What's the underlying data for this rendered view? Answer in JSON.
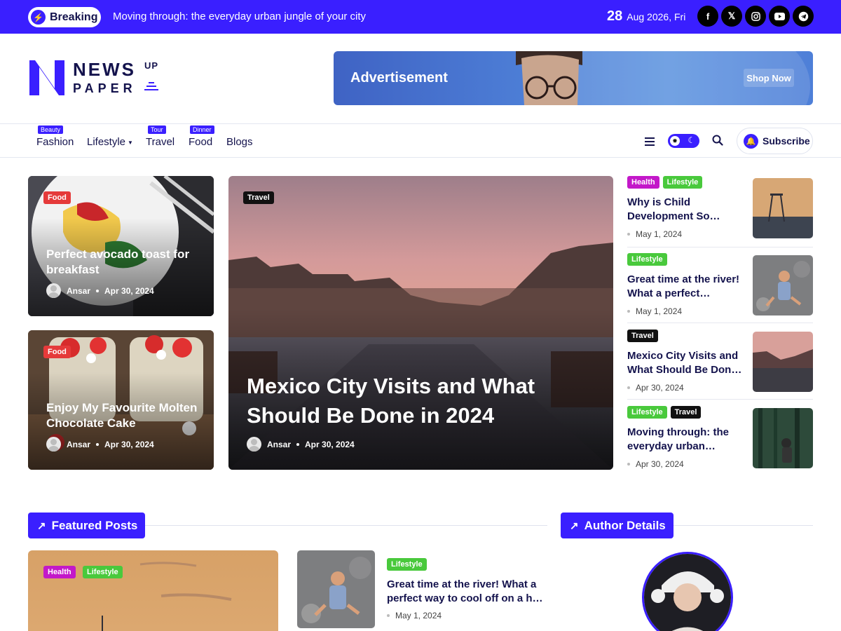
{
  "topbar": {
    "breaking_label": "Breaking",
    "ticker": "Moving through: the everyday urban jungle of your city",
    "date_day": "28",
    "date_rest": "Aug 2026, Fri",
    "socials": [
      "facebook-icon",
      "x-icon",
      "instagram-icon",
      "youtube-icon",
      "telegram-icon"
    ]
  },
  "logo": {
    "word1": "NEWS",
    "word2": "PAPER",
    "word3": "UP"
  },
  "ad": {
    "label": "Advertisement",
    "cta": "Shop Now"
  },
  "nav": {
    "items": [
      {
        "label": "Fashion",
        "tag": "Beauty"
      },
      {
        "label": "Lifestyle",
        "tag": ""
      },
      {
        "label": "Travel",
        "tag": "Tour"
      },
      {
        "label": "Food",
        "tag": "Dinner"
      },
      {
        "label": "Blogs",
        "tag": ""
      }
    ],
    "subscribe": "Subscribe"
  },
  "cards": {
    "left1": {
      "tag": "Food",
      "title": "Perfect avocado toast for breakfast",
      "author": "Ansar",
      "date": "Apr 30, 2024"
    },
    "left2": {
      "tag": "Food",
      "title": "Enjoy My Favourite Molten Chocolate Cake",
      "author": "Ansar",
      "date": "Apr 30, 2024"
    },
    "main": {
      "tag": "Travel",
      "title": "Mexico City Visits and What Should Be Done in 2024",
      "author": "Ansar",
      "date": "Apr 30, 2024"
    }
  },
  "side": [
    {
      "tags": [
        "Health",
        "Lifestyle"
      ],
      "title": "Why is Child Development So…",
      "date": "May 1, 2024"
    },
    {
      "tags": [
        "Lifestyle"
      ],
      "title": "Great time at the river! What a perfect…",
      "date": "May 1, 2024"
    },
    {
      "tags": [
        "Travel"
      ],
      "title": "Mexico City Visits and What Should Be Don…",
      "date": "Apr 30, 2024"
    },
    {
      "tags": [
        "Lifestyle",
        "Travel"
      ],
      "title": "Moving through: the everyday urban…",
      "date": "Apr 30, 2024"
    }
  ],
  "featured": {
    "heading": "Featured Posts",
    "big_tags": [
      "Health",
      "Lifestyle"
    ],
    "item": {
      "tag": "Lifestyle",
      "title": "Great time at the river! What a perfect way to cool off on a h…",
      "date": "May 1, 2024"
    }
  },
  "author": {
    "heading": "Author Details"
  },
  "colors": {
    "brand": "#3a1fff",
    "food": "#e53a3a",
    "health": "#c318c9",
    "lifestyle": "#49c93c",
    "travel": "#111111"
  }
}
